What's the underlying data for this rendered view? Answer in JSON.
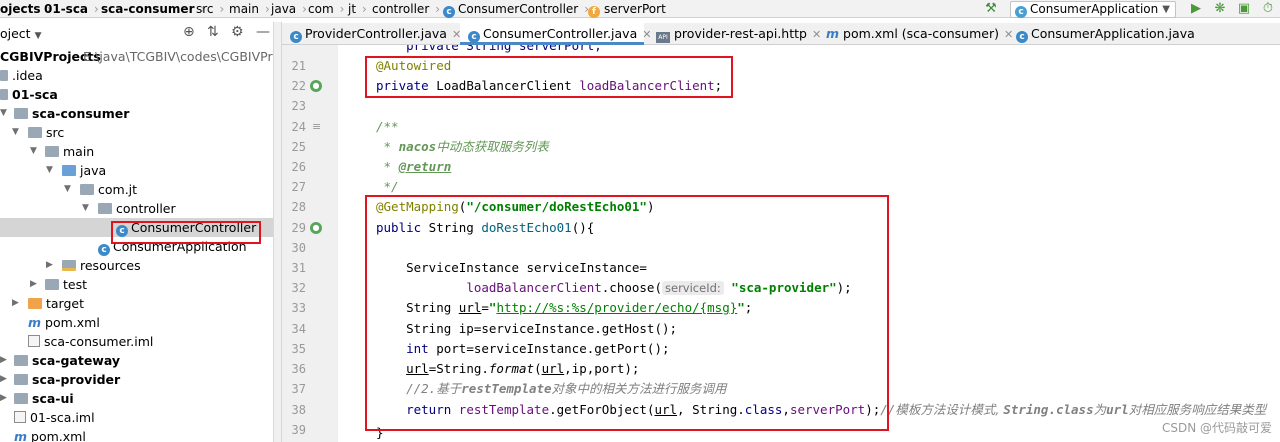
{
  "breadcrumb": [
    "ojects",
    "01-sca",
    "sca-consumer",
    "src",
    "main",
    "java",
    "com",
    "jt",
    "controller",
    "ConsumerController",
    "serverPort"
  ],
  "toolbar": {
    "run_config": "ConsumerApplication",
    "icons": [
      "hammer-icon",
      "run-icon",
      "debug-icon",
      "coverage-icon",
      "profile-icon"
    ]
  },
  "tree_header": {
    "label": "oject",
    "icons": [
      "locate-icon",
      "collapse-icon",
      "settings-icon",
      "hide-icon"
    ]
  },
  "tabs": [
    {
      "label": "ProviderController.java",
      "icon": "java-class-icon",
      "active": false
    },
    {
      "label": "ConsumerController.java",
      "icon": "java-class-icon",
      "active": true
    },
    {
      "label": "provider-rest-api.http",
      "icon": "api-file-icon",
      "active": false
    },
    {
      "label": "pom.xml (sca-consumer)",
      "icon": "maven-icon",
      "active": false
    },
    {
      "label": "ConsumerApplication.java",
      "icon": "java-class-icon",
      "active": false
    }
  ],
  "tree": [
    {
      "name": "CGBIVProjects",
      "extra": "E:\\java\\TCGBIV\\codes\\CGBIVProjects"
    },
    {
      "name": ".idea"
    },
    {
      "name": "01-sca"
    },
    {
      "name": "sca-consumer"
    },
    {
      "name": "src"
    },
    {
      "name": "main"
    },
    {
      "name": "java"
    },
    {
      "name": "com.jt"
    },
    {
      "name": "controller"
    },
    {
      "name": "ConsumerController"
    },
    {
      "name": "ConsumerApplication"
    },
    {
      "name": "resources"
    },
    {
      "name": "test"
    },
    {
      "name": "target"
    },
    {
      "name": "pom.xml"
    },
    {
      "name": "sca-consumer.iml"
    },
    {
      "name": "sca-gateway"
    },
    {
      "name": "sca-provider"
    },
    {
      "name": "sca-ui"
    },
    {
      "name": "01-sca.iml"
    },
    {
      "name": "pom.xml"
    }
  ],
  "line_numbers": [
    "21",
    "22",
    "23",
    "24",
    "25",
    "26",
    "27",
    "28",
    "29",
    "30",
    "31",
    "32",
    "33",
    "34",
    "35",
    "36",
    "37",
    "38",
    "39"
  ],
  "code": {
    "l20": "    private String serverPort;",
    "l21_ann": "@Autowired",
    "l22_kw": "private",
    "l22_type": " LoadBalancerClient ",
    "l22_field": "loadBalancerClient",
    "l22_end": ";",
    "l24": "/**",
    "l25_star": " * ",
    "l25_tag": "nacos",
    "l25_text": "中动态获取服务列表",
    "l26_star": " * ",
    "l26_tag": "@return",
    "l27": " */",
    "l28_ann": "@GetMapping",
    "l28_open": "(",
    "l28_str": "\"/consumer/doRestEcho01\"",
    "l28_close": ")",
    "l29_kw": "public",
    "l29_rest": " String ",
    "l29_method": "doRestEcho01",
    "l29_end": "(){",
    "l31": "    ServiceInstance serviceInstance=",
    "l32_pre": "            ",
    "l32_field": "loadBalancerClient",
    "l32_call": ".choose(",
    "l32_hint": "serviceId:",
    "l32_str": "\"sca-provider\"",
    "l32_end": ");",
    "l33_pre": "    String ",
    "l33_var": "url",
    "l33_eq": "=",
    "l33_q1": "\"",
    "l33_url": "http://%s:%s/provider/echo/{msg}",
    "l33_q2": "\"",
    "l33_end": ";",
    "l34": "    String ip=serviceInstance.getHost();",
    "l35_kw": "int",
    "l35_rest": " port=serviceInstance.getPort();",
    "l36_var": "url",
    "l36_eq": "=String.",
    "l36_fmt": "format",
    "l36_open": "(",
    "l36_var2": "url",
    "l36_end": ",ip,port);",
    "l37_cmt": "//2.",
    "l37_chi1": "基于",
    "l37_b": "restTemplate",
    "l37_chi2": "对象中的相关方法进行服务调用",
    "l38_kw": "return",
    "l38_sp": " ",
    "l38_field": "restTemplate",
    "l38_call": ".getForObject(",
    "l38_var": "url",
    "l38_mid": ", String.",
    "l38_cls": "class",
    "l38_comma": ",",
    "l38_field2": "serverPort",
    "l38_end": ");",
    "l38_cmt1": "//",
    "l38_chi1": "模板方法设计模式, ",
    "l38_cls2": "String.class",
    "l38_chi2": "为",
    "l38_url": "url",
    "l38_chi3": "对相应服务响应结果类型",
    "l39": "}"
  },
  "watermark": "CSDN @代码敲可爱"
}
